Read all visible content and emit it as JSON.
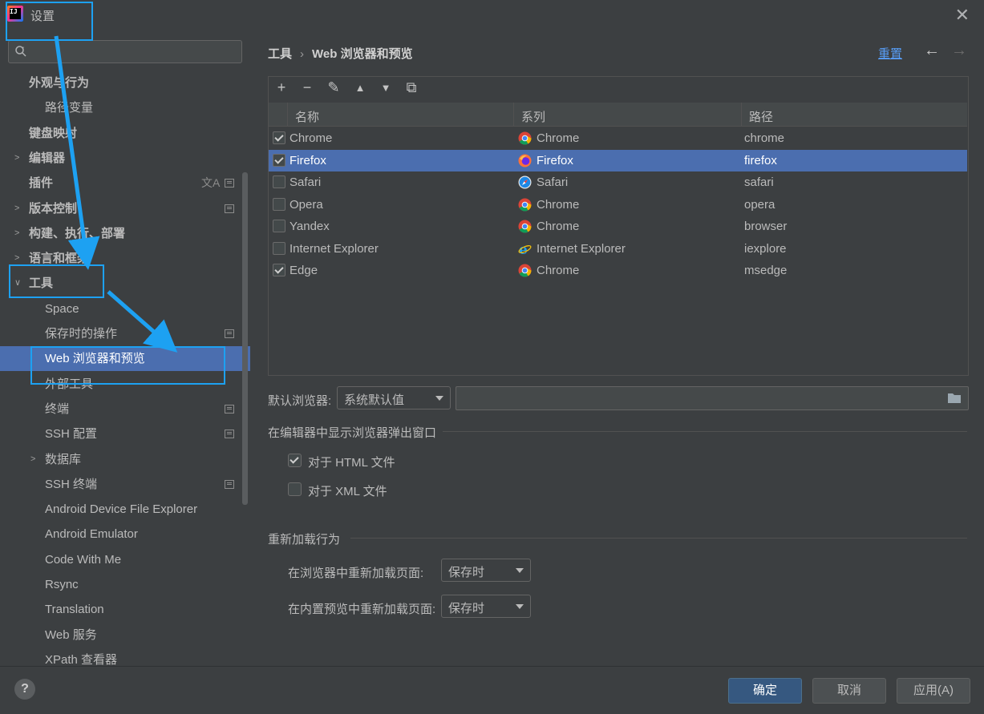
{
  "window": {
    "title": "设置"
  },
  "sidebar": {
    "items": [
      {
        "label": "外观与行为",
        "level": 0,
        "bold": true,
        "chevron": "",
        "badge": false
      },
      {
        "label": "路径变量",
        "level": 1,
        "bold": false,
        "chevron": "",
        "badge": false
      },
      {
        "label": "键盘映射",
        "level": 0,
        "bold": true,
        "chevron": "",
        "badge": false
      },
      {
        "label": "编辑器",
        "level": 0,
        "bold": true,
        "chevron": "right",
        "badge": false
      },
      {
        "label": "插件",
        "level": 0,
        "bold": true,
        "chevron": "",
        "badge": true,
        "translate": true
      },
      {
        "label": "版本控制",
        "level": 0,
        "bold": true,
        "chevron": "right",
        "badge": true
      },
      {
        "label": "构建、执行、部署",
        "level": 0,
        "bold": true,
        "chevron": "right",
        "badge": false
      },
      {
        "label": "语言和框架",
        "level": 0,
        "bold": true,
        "chevron": "right",
        "badge": false
      },
      {
        "label": "工具",
        "level": 0,
        "bold": true,
        "chevron": "down",
        "badge": false
      },
      {
        "label": "Space",
        "level": 1,
        "bold": false,
        "chevron": "",
        "badge": false
      },
      {
        "label": "保存时的操作",
        "level": 1,
        "bold": false,
        "chevron": "",
        "badge": true
      },
      {
        "label": "Web 浏览器和预览",
        "level": 1,
        "bold": false,
        "chevron": "",
        "badge": false,
        "selected": true
      },
      {
        "label": "外部工具",
        "level": 1,
        "bold": false,
        "chevron": "",
        "badge": false
      },
      {
        "label": "终端",
        "level": 1,
        "bold": false,
        "chevron": "",
        "badge": true
      },
      {
        "label": "SSH 配置",
        "level": 1,
        "bold": false,
        "chevron": "",
        "badge": true
      },
      {
        "label": "数据库",
        "level": 1,
        "bold": false,
        "chevron": "right",
        "badge": false
      },
      {
        "label": "SSH 终端",
        "level": 1,
        "bold": false,
        "chevron": "",
        "badge": true
      },
      {
        "label": "Android Device File Explorer",
        "level": 1,
        "bold": false,
        "chevron": "",
        "badge": false
      },
      {
        "label": "Android Emulator",
        "level": 1,
        "bold": false,
        "chevron": "",
        "badge": false
      },
      {
        "label": "Code With Me",
        "level": 1,
        "bold": false,
        "chevron": "",
        "badge": false
      },
      {
        "label": "Rsync",
        "level": 1,
        "bold": false,
        "chevron": "",
        "badge": false
      },
      {
        "label": "Translation",
        "level": 1,
        "bold": false,
        "chevron": "",
        "badge": false
      },
      {
        "label": "Web 服务",
        "level": 1,
        "bold": false,
        "chevron": "",
        "badge": false
      },
      {
        "label": "XPath 查看器",
        "level": 1,
        "bold": false,
        "chevron": "",
        "badge": false
      }
    ]
  },
  "header": {
    "crumb_parent": "工具",
    "crumb_sep": "›",
    "crumb_current": "Web 浏览器和预览",
    "reset": "重置",
    "back_icon": "←",
    "forward_icon": "→"
  },
  "toolbar": {
    "add": "+",
    "remove": "−",
    "edit": "✎",
    "up": "▲",
    "down": "▼",
    "copy": "⧉"
  },
  "table": {
    "columns": [
      "名称",
      "系列",
      "路径"
    ],
    "rows": [
      {
        "enabled": true,
        "name": "Chrome",
        "family": "Chrome",
        "icon": "chrome-icon",
        "path": "chrome",
        "selected": false
      },
      {
        "enabled": true,
        "name": "Firefox",
        "family": "Firefox",
        "icon": "firefox-icon",
        "path": "firefox",
        "selected": true
      },
      {
        "enabled": false,
        "name": "Safari",
        "family": "Safari",
        "icon": "safari-icon",
        "path": "safari",
        "selected": false
      },
      {
        "enabled": false,
        "name": "Opera",
        "family": "Chrome",
        "icon": "chrome-icon",
        "path": "opera",
        "selected": false
      },
      {
        "enabled": false,
        "name": "Yandex",
        "family": "Chrome",
        "icon": "chrome-icon",
        "path": "browser",
        "selected": false
      },
      {
        "enabled": false,
        "name": "Internet Explorer",
        "family": "Internet Explorer",
        "icon": "ie-icon",
        "path": "iexplore",
        "selected": false
      },
      {
        "enabled": true,
        "name": "Edge",
        "family": "Chrome",
        "icon": "chrome-icon",
        "path": "msedge",
        "selected": false
      }
    ]
  },
  "default_browser": {
    "label": "默认浏览器:",
    "value": "系统默认值",
    "path_value": ""
  },
  "popup_section": {
    "title": "在编辑器中显示浏览器弹出窗口",
    "html_label": "对于 HTML 文件",
    "html_checked": true,
    "xml_label": "对于 XML 文件",
    "xml_checked": false
  },
  "reload_section": {
    "title": "重新加载行为",
    "browser_label": "在浏览器中重新加载页面:",
    "browser_value": "保存时",
    "preview_label": "在内置预览中重新加载页面:",
    "preview_value": "保存时"
  },
  "footer": {
    "help": "?",
    "ok": "确定",
    "cancel": "取消",
    "apply": "应用(A)"
  },
  "colors": {
    "accent": "#4b6eaf",
    "link": "#589df6",
    "annotation": "#1da1f2",
    "background": "#3c3f41"
  }
}
